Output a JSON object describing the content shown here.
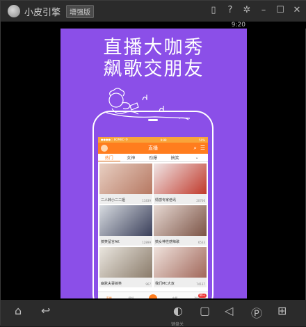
{
  "window": {
    "app_title": "小皮引擎",
    "edition_badge": "增强版",
    "status_time": "9:20"
  },
  "screen": {
    "headline_line1": "直播大咖秀",
    "headline_line2": "飙歌交朋友"
  },
  "inner_app": {
    "status_carrier": "●●●●○ BOMBO 令",
    "status_time": "9:88",
    "status_battery": "50%",
    "title": "直播",
    "tabs": [
      "热门",
      "女神",
      "劲爆",
      "搞笑"
    ],
    "cards": [
      {
        "caption": "二人转小二二姐",
        "count": "11839"
      },
      {
        "caption": "情感专家倍讯",
        "count": "20706"
      },
      {
        "caption": "搞笑留言AK",
        "count": "12899"
      },
      {
        "caption": "搞女神性感辣歌",
        "count": "6533"
      },
      {
        "caption": "幽默夫妻搞笑",
        "count": "967"
      },
      {
        "caption": "我们MC大叔",
        "count": "74137"
      }
    ],
    "tabbar": [
      {
        "label": "直播"
      },
      {
        "label": "视频"
      },
      {
        "label": ""
      },
      {
        "label": "电影"
      },
      {
        "label": "消息",
        "badge": "99+"
      }
    ]
  },
  "bottombar": {
    "keyboard_label": "键盘关"
  },
  "colors": {
    "screen_bg": "#8b4fe8",
    "inner_accent": "#ff7d1e"
  }
}
